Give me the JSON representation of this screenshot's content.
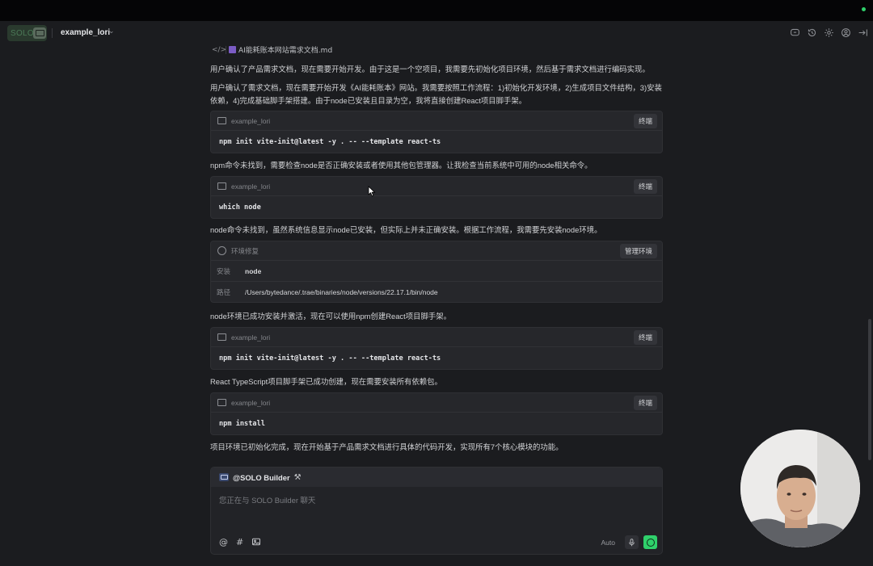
{
  "header": {
    "logo_text": "SOLO",
    "project_name": "example_lori"
  },
  "file_ref": {
    "name": "AI能耗账本网站需求文档.md"
  },
  "messages": [
    "用户确认了产品需求文档，现在需要开始开发。由于这是一个空项目，我需要先初始化项目环境，然后基于需求文档进行编码实现。",
    "用户确认了需求文档，现在需要开始开发《AI能耗账本》网站。我需要按照工作流程：1)初始化开发环境，2)生成项目文件结构，3)安装依赖，4)完成基础脚手架搭建。由于node已安装且目录为空，我将直接创建React项目脚手架。",
    "npm命令未找到，需要检查node是否正确安装或者使用其他包管理器。让我检查当前系统中可用的node相关命令。",
    "node命令未找到，虽然系统信息显示node已安装，但实际上并未正确安装。根据工作流程，我需要先安装node环境。",
    "node环境已成功安装并激活，现在可以使用npm创建React项目脚手架。",
    "React TypeScript项目脚手架已成功创建，现在需要安装所有依赖包。",
    "项目环境已初始化完成，现在开始基于产品需求文档进行具体的代码开发，实现所有7个核心模块的功能。"
  ],
  "terminal_cards": [
    {
      "cwd": "example_lori",
      "button": "终端",
      "command": "npm init vite-init@latest -y . -- --template react-ts"
    },
    {
      "cwd": "example_lori",
      "button": "终端",
      "command": "which node"
    },
    {
      "cwd": "example_lori",
      "button": "终端",
      "command": "npm init vite-init@latest -y . -- --template react-ts"
    },
    {
      "cwd": "example_lori",
      "button": "终端",
      "command": "npm install"
    }
  ],
  "env_card": {
    "title": "环境修复",
    "button": "管理环境",
    "install_label": "安装",
    "install_value": "node",
    "path_label": "路径",
    "path_value": "/Users/bytedance/.trae/binaries/node/versions/22.17.1/bin/node"
  },
  "chat": {
    "agent": "@SOLO Builder",
    "placeholder": "您正在与 SOLO Builder 聊天",
    "mode": "Auto"
  },
  "colors": {
    "accent": "#2fd06b",
    "background": "#1b1c1f",
    "card": "#26272b"
  }
}
